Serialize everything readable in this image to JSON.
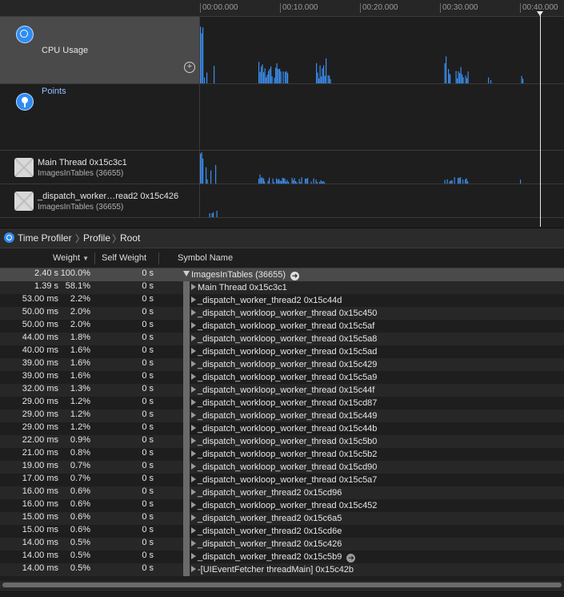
{
  "ruler": {
    "ticks": [
      "00:00.000",
      "00:10.000",
      "00:20.000",
      "00:30.000",
      "00:40.000"
    ]
  },
  "tracks": {
    "cpu": {
      "title": "CPU Usage",
      "add_button": "+",
      "icon": "cpu-usage-icon"
    },
    "points": {
      "title": "Points",
      "icon": "points-pin-icon"
    },
    "main_thread": {
      "title": "Main Thread  0x15c3c1",
      "subtitle": "ImagesInTables (36655)",
      "icon": "thread-icon"
    },
    "worker_thread": {
      "title": "_dispatch_worker…read2  0x15c426",
      "subtitle": "ImagesInTables (36655)",
      "icon": "thread-icon"
    }
  },
  "jumpbar": {
    "items": [
      "Time Profiler",
      "Profile",
      "Root"
    ],
    "icon": "time-profiler-icon"
  },
  "columns": {
    "weight": "Weight",
    "self_weight": "Self Weight",
    "symbol_name": "Symbol Name"
  },
  "rows": [
    {
      "weight": "2.40 s",
      "pct": "100.0%",
      "self": "0 s",
      "symbol": "ImagesInTables (36655)",
      "open": true,
      "root": true
    },
    {
      "weight": "1.39 s",
      "pct": "58.1%",
      "self": "0 s",
      "symbol": "Main Thread  0x15c3c1"
    },
    {
      "weight": "53.00 ms",
      "pct": "2.2%",
      "self": "0 s",
      "symbol": "_dispatch_worker_thread2  0x15c44d"
    },
    {
      "weight": "50.00 ms",
      "pct": "2.0%",
      "self": "0 s",
      "symbol": "_dispatch_workloop_worker_thread  0x15c450"
    },
    {
      "weight": "50.00 ms",
      "pct": "2.0%",
      "self": "0 s",
      "symbol": "_dispatch_workloop_worker_thread  0x15c5af"
    },
    {
      "weight": "44.00 ms",
      "pct": "1.8%",
      "self": "0 s",
      "symbol": "_dispatch_workloop_worker_thread  0x15c5a8"
    },
    {
      "weight": "40.00 ms",
      "pct": "1.6%",
      "self": "0 s",
      "symbol": "_dispatch_workloop_worker_thread  0x15c5ad"
    },
    {
      "weight": "39.00 ms",
      "pct": "1.6%",
      "self": "0 s",
      "symbol": "_dispatch_workloop_worker_thread  0x15c429"
    },
    {
      "weight": "39.00 ms",
      "pct": "1.6%",
      "self": "0 s",
      "symbol": "_dispatch_workloop_worker_thread  0x15c5a9"
    },
    {
      "weight": "32.00 ms",
      "pct": "1.3%",
      "self": "0 s",
      "symbol": "_dispatch_workloop_worker_thread  0x15c44f"
    },
    {
      "weight": "29.00 ms",
      "pct": "1.2%",
      "self": "0 s",
      "symbol": "_dispatch_workloop_worker_thread  0x15cd87"
    },
    {
      "weight": "29.00 ms",
      "pct": "1.2%",
      "self": "0 s",
      "symbol": "_dispatch_workloop_worker_thread  0x15c449"
    },
    {
      "weight": "29.00 ms",
      "pct": "1.2%",
      "self": "0 s",
      "symbol": "_dispatch_workloop_worker_thread  0x15c44b"
    },
    {
      "weight": "22.00 ms",
      "pct": "0.9%",
      "self": "0 s",
      "symbol": "_dispatch_workloop_worker_thread  0x15c5b0"
    },
    {
      "weight": "21.00 ms",
      "pct": "0.8%",
      "self": "0 s",
      "symbol": "_dispatch_workloop_worker_thread  0x15c5b2"
    },
    {
      "weight": "19.00 ms",
      "pct": "0.7%",
      "self": "0 s",
      "symbol": "_dispatch_workloop_worker_thread  0x15cd90"
    },
    {
      "weight": "17.00 ms",
      "pct": "0.7%",
      "self": "0 s",
      "symbol": "_dispatch_workloop_worker_thread  0x15c5a7"
    },
    {
      "weight": "16.00 ms",
      "pct": "0.6%",
      "self": "0 s",
      "symbol": "_dispatch_worker_thread2  0x15cd96"
    },
    {
      "weight": "16.00 ms",
      "pct": "0.6%",
      "self": "0 s",
      "symbol": "_dispatch_workloop_worker_thread  0x15c452"
    },
    {
      "weight": "15.00 ms",
      "pct": "0.6%",
      "self": "0 s",
      "symbol": "_dispatch_worker_thread2  0x15c6a5"
    },
    {
      "weight": "15.00 ms",
      "pct": "0.6%",
      "self": "0 s",
      "symbol": "_dispatch_worker_thread2  0x15cd6e"
    },
    {
      "weight": "14.00 ms",
      "pct": "0.5%",
      "self": "0 s",
      "symbol": "_dispatch_worker_thread2  0x15c426"
    },
    {
      "weight": "14.00 ms",
      "pct": "0.5%",
      "self": "0 s",
      "symbol": "_dispatch_worker_thread2  0x15c5b9",
      "go": true
    },
    {
      "weight": "14.00 ms",
      "pct": "0.5%",
      "self": "0 s",
      "symbol": "-[UIEventFetcher threadMain]  0x15c42b"
    }
  ],
  "colors": {
    "accent": "#2f8cf0",
    "graph_fill": "#3b8ef0",
    "background": "#1e1e1e"
  }
}
